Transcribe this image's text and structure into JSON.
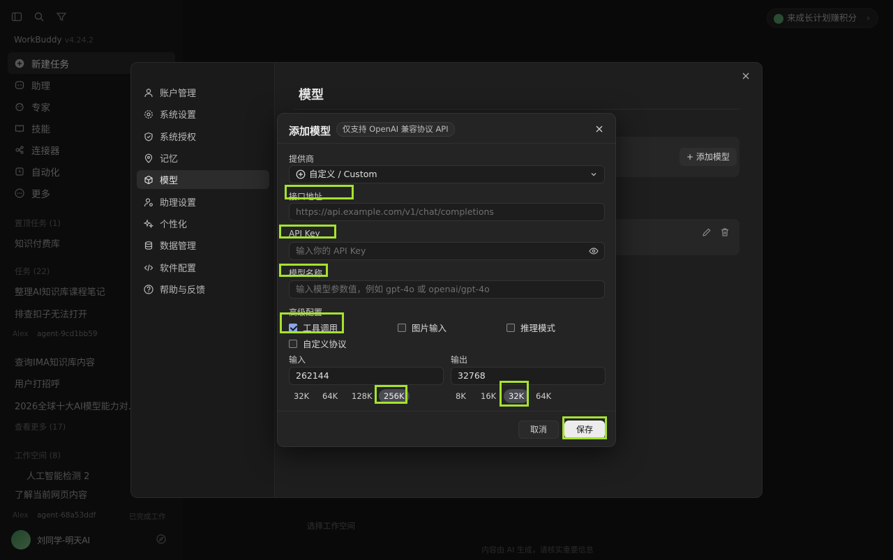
{
  "app": {
    "brand": "WorkBuddy",
    "version": "v4.24.2",
    "points_pill": "来成长计划赚积分",
    "nav": [
      {
        "label": "新建任务",
        "icon": "plus-circle-icon",
        "active": true
      },
      {
        "label": "助理",
        "icon": "assistant-icon"
      },
      {
        "label": "专家",
        "icon": "expert-icon"
      },
      {
        "label": "技能",
        "icon": "book-icon"
      },
      {
        "label": "连接器",
        "icon": "connector-icon"
      },
      {
        "label": "自动化",
        "icon": "alarm-icon"
      },
      {
        "label": "更多",
        "icon": "more-icon"
      }
    ],
    "pinned_title": "置顶任务 (1)",
    "pinned_items": [
      "知识付费库"
    ],
    "tasks_title": "任务 (22)",
    "tasks": [
      "整理AI知识库课程笔记",
      "排查扣子无法打开"
    ],
    "task_sub_user": "Alex",
    "task_sub_agent": "agent-9cd1bb59",
    "tasks_more": [
      "查询IMA知识库内容",
      "用户打招呼",
      "2026全球十大AI模型能力对..."
    ],
    "see_more": "查看更多 (17)",
    "workspace_title": "工作空间 (8)",
    "workspace_items": [
      "人工智能检测 2",
      "了解当前网页内容"
    ],
    "ws_sub_user": "Alex",
    "ws_sub_agent": "agent-68a53ddf",
    "ws_sub_status": "已完成工作",
    "user_name": "刘同学-明天AI",
    "select_workspace": "选择工作空间",
    "footer_note": "内容由 AI 生成，请核实重要信息"
  },
  "settings": {
    "title": "模型",
    "nav": [
      {
        "label": "账户管理",
        "icon": "user-icon"
      },
      {
        "label": "系统设置",
        "icon": "gear-icon"
      },
      {
        "label": "系统授权",
        "icon": "shield-icon"
      },
      {
        "label": "记忆",
        "icon": "pin-icon"
      },
      {
        "label": "模型",
        "icon": "cube-icon",
        "active": true
      },
      {
        "label": "助理设置",
        "icon": "user-gear-icon"
      },
      {
        "label": "个性化",
        "icon": "sparkle-icon"
      },
      {
        "label": "数据管理",
        "icon": "database-icon"
      },
      {
        "label": "软件配置",
        "icon": "code-icon"
      },
      {
        "label": "帮助与反馈",
        "icon": "help-icon"
      }
    ],
    "add_model_button": "+ 添加模型"
  },
  "dialog": {
    "title": "添加模型",
    "badge": "仅支持 OpenAI 兼容协议 API",
    "provider_label": "提供商",
    "provider_value": "自定义 / Custom",
    "endpoint_label": "接口地址",
    "endpoint_placeholder": "https://api.example.com/v1/chat/completions",
    "apikey_label": "API Key",
    "apikey_placeholder": "输入你的 API Key",
    "model_name_label": "模型名称",
    "model_name_placeholder": "输入模型参数值，例如 gpt-4o 或 openai/gpt-4o",
    "advanced_label": "高级配置",
    "options": [
      {
        "label": "工具调用",
        "checked": true
      },
      {
        "label": "图片输入",
        "checked": false
      },
      {
        "label": "推理模式",
        "checked": false
      },
      {
        "label": "自定义协议",
        "checked": false
      }
    ],
    "input_label": "输入",
    "input_value": "262144",
    "input_chips": [
      "32K",
      "64K",
      "128K",
      "256K"
    ],
    "input_selected": "256K",
    "output_label": "输出",
    "output_value": "32768",
    "output_chips": [
      "8K",
      "16K",
      "32K",
      "64K"
    ],
    "output_selected": "32K",
    "cancel": "取消",
    "save": "保存"
  },
  "colors": {
    "highlight": "#a6e22e",
    "save_bg": "#ececec",
    "check": "#8aa6e6"
  }
}
